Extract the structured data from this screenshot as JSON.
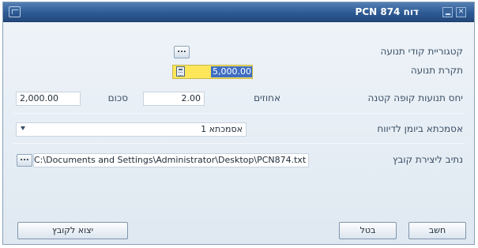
{
  "window": {
    "title": "דוח PCN 874"
  },
  "fields": {
    "movement_categories": {
      "label": "קטגוריית קודי תנועה",
      "button": "..."
    },
    "movement_cap": {
      "label": "תקרת תנועה",
      "value": "5,000.00"
    },
    "petty_cash_ratio": {
      "label": "יחס תנועות קופה קטנה",
      "percent_label": "אחוזים",
      "percent_value": "2.00",
      "amount_label": "סכום",
      "amount_value": "2,000.00"
    },
    "report_journal_batch": {
      "label": "אסמכתא ביומן לדיווח",
      "value": "אסמכתא 1"
    },
    "file_path": {
      "label": "נתיב ליצירת קובץ",
      "value": "C:\\Documents and Settings\\Administrator\\Desktop\\PCN874.txt",
      "button": "..."
    }
  },
  "buttons": {
    "calculate": "חשב",
    "cancel": "בטל",
    "export": "יצוא לקובץ"
  },
  "colors": {
    "titlebar": "#2d5a94",
    "highlight": "#fde65a",
    "selection": "#3f6ec2"
  }
}
